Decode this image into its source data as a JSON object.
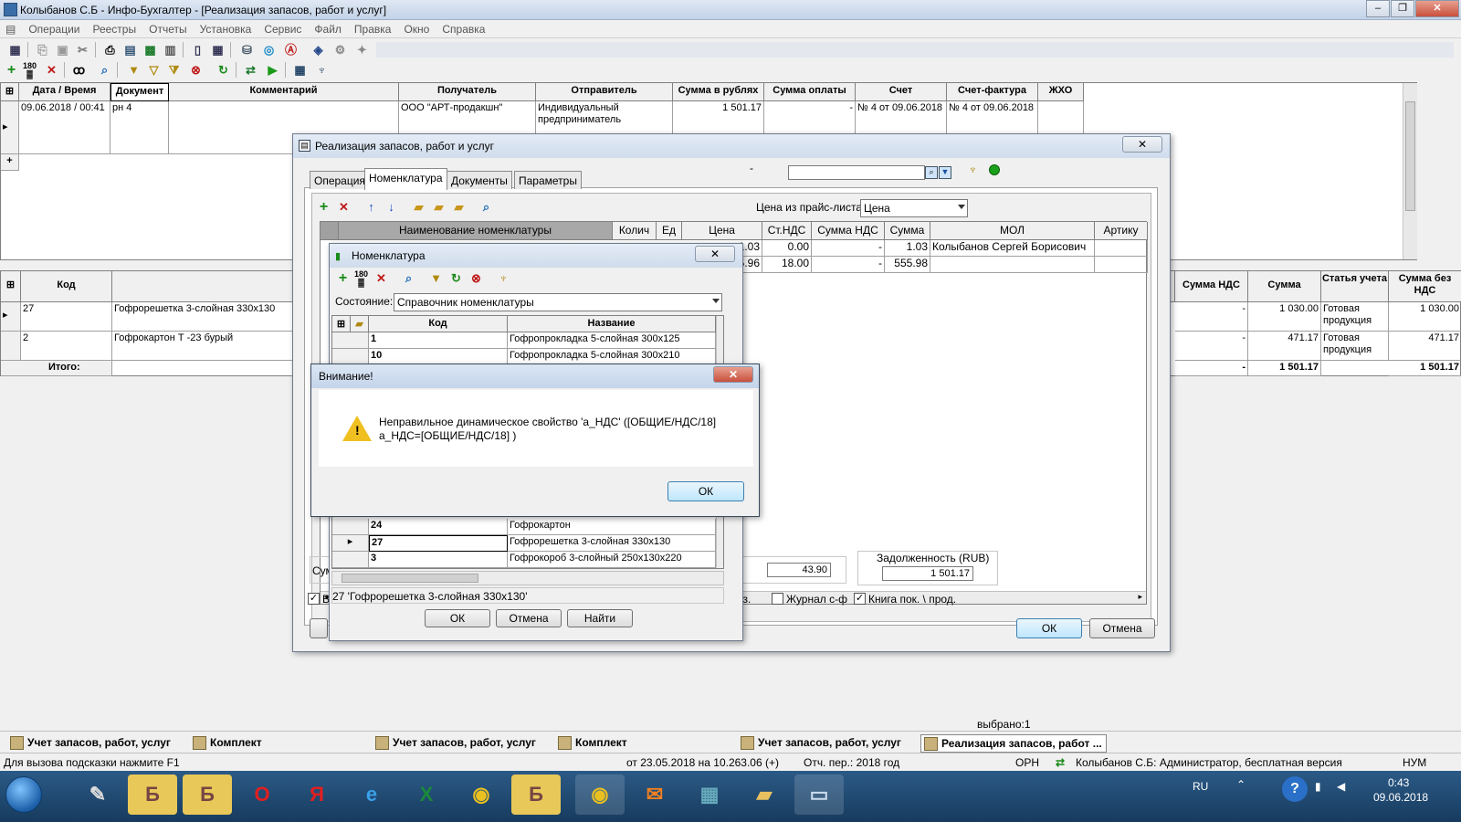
{
  "app": {
    "title": "Колыбанов С.Б - Инфо-Бухгалтер - [Реализация запасов, работ и услуг]"
  },
  "menu": [
    "Операции",
    "Реестры",
    "Отчеты",
    "Установка",
    "Сервис",
    "Файл",
    "Правка",
    "Окно",
    "Справка"
  ],
  "main_grid": {
    "headers": [
      "Дата / Время",
      "Документ",
      "Комментарий",
      "Получатель",
      "Отправитель",
      "Сумма в рублях",
      "Сумма оплаты",
      "Счет",
      "Счет-фактура",
      "ЖХО"
    ],
    "row": {
      "datetime": "09.06.2018 / 00:41",
      "doc": "рн 4",
      "comment": "",
      "recipient": "ООО \"АРТ-продакшн\"",
      "sender": "Индивидуальный предприниматель",
      "sum": "1 501.17",
      "paid": "-",
      "invoice": "№ 4 от 09.06.2018",
      "factura": "№ 4 от 09.06.2018",
      "jho": ""
    },
    "row_marker": "▸",
    "add_marker": "+"
  },
  "lower_grid": {
    "headers": {
      "code": "Код",
      "vat_sum": "Сумма НДС",
      "sum": "Сумма",
      "article": "Статья учета",
      "sum_no_vat": "Сумма без НДС"
    },
    "rows": [
      {
        "code": "27",
        "name": "Гофрорешетка 3-слойная 330х130",
        "vat_sum": "-",
        "sum": "1 030.00",
        "article": "Готовая продукция",
        "sum_no_vat": "1 030.00"
      },
      {
        "code": "2",
        "name": "Гофрокартон Т -23 бурый",
        "vat_sum": "-",
        "sum": "471.17",
        "article": "Готовая продукция",
        "sum_no_vat": "471.17"
      }
    ],
    "total": {
      "label": "Итого:",
      "vat_sum": "-",
      "sum": "1 501.17",
      "sum_no_vat": "1 501.17"
    }
  },
  "realization_dialog": {
    "title": "Реализация запасов, работ и услуг",
    "tabs": [
      "Операция",
      "Номенклатура",
      "Документы",
      "Параметры"
    ],
    "price_label": "Цена из прайс-листа:",
    "price_value": "Цена",
    "dash": "-",
    "grid_headers": [
      "Наименование номенклатуры",
      "Колич",
      "Ед",
      "Цена",
      "Ст.НДС",
      "Сумма НДС",
      "Сумма",
      "МОЛ",
      "Артику"
    ],
    "rows": [
      {
        "price": "1.03",
        "vat_rate": "0.00",
        "vat_sum": "-",
        "sum": "1.03",
        "mol": "Колыбанов Сергей Борисович"
      },
      {
        "price": "555.96",
        "vat_rate": "18.00",
        "vat_sum": "-",
        "sum": "555.98",
        "mol": ""
      }
    ],
    "sum_label": "Сум",
    "sum_partial": "43.90",
    "debt_label": "Задолженность (RUB)",
    "debt_value": "1 501.17",
    "chk_b": "В",
    "chk_pos": "оз.",
    "journal_label": "Журнал с-ф",
    "book_label": "Книга пок. \\ прод.",
    "ok": "ОК",
    "cancel": "Отмена"
  },
  "nomenclature_dialog": {
    "title": "Номенклатура",
    "state_label": "Состояние:",
    "state_value": "Справочник номенклатуры",
    "col_code": "Код",
    "col_name": "Название",
    "rows": [
      {
        "code": "1",
        "name": "Гофропрокладка 5-слойная 300х125"
      },
      {
        "code": "10",
        "name": "Гофропрокладка 5-слойная 300х210"
      },
      {
        "code": "24",
        "name": "Гофрокартон"
      },
      {
        "code": "27",
        "name": "Гофрорешетка 3-слойная 330х130"
      },
      {
        "code": "3",
        "name": "Гофрокороб 3-слойный 250х130х220"
      }
    ],
    "selected": "27 'Гофрорешетка 3-слойная 330х130'",
    "ok": "ОК",
    "cancel": "Отмена",
    "find": "Найти"
  },
  "alert": {
    "title": "Внимание!",
    "message_line1": "Неправильное динамическое свойство 'а_НДС' ([ОБЩИЕ/НДС/18]",
    "message_line2": "а_НДС=[ОБЩИЕ/НДС/18] )",
    "ok": "ОК"
  },
  "selected_count": "выбрано:1",
  "taskrow": [
    {
      "label": "Учет запасов, работ, услуг"
    },
    {
      "label": "Комплект"
    },
    {
      "label": "Учет запасов, работ, услуг"
    },
    {
      "label": "Комплект"
    },
    {
      "label": "Учет запасов, работ, услуг"
    },
    {
      "label": "Реализация запасов, работ ..."
    }
  ],
  "status": {
    "hint": "Для вызова подсказки нажмите F1",
    "period": "от 23.05.2018 на 10.263.06 (+)",
    "report": "Отч. пер.: 2018 год",
    "org": "ОРН",
    "user": "Колыбанов С.Б: Администратор, бесплатная версия",
    "num": "НУМ"
  },
  "taskbar": {
    "lang": "RU",
    "time": "0:43",
    "date": "09.06.2018"
  }
}
